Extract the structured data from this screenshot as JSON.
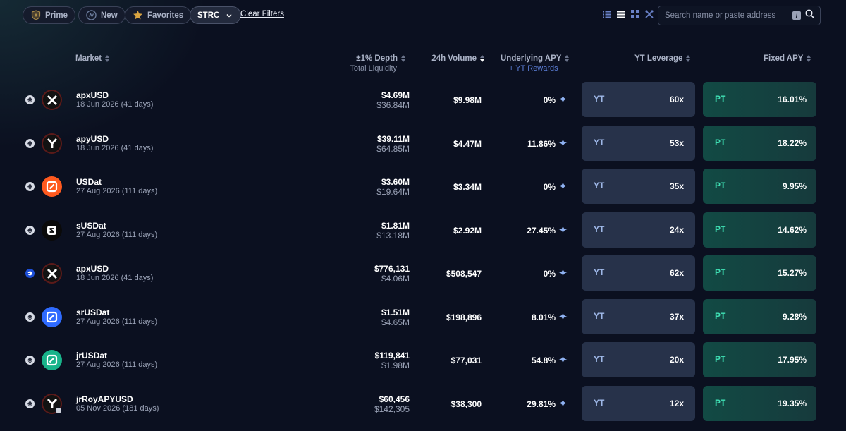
{
  "filters": {
    "prime_label": "Prime",
    "new_label": "New",
    "favorites_label": "Favorites",
    "strc_label": "STRC",
    "clear_label": "Clear Filters"
  },
  "search": {
    "placeholder": "Search name or paste address",
    "shortcut": "/"
  },
  "header": {
    "market": "Market",
    "depth": "±1% Depth",
    "total_liquidity": "Total Liquidity",
    "volume": "24h Volume",
    "underlying_apy": "Underlying APY",
    "yt_rewards": "+ YT Rewards",
    "yt_leverage": "YT Leverage",
    "fixed_apy": "Fixed APY"
  },
  "colors": {
    "background": "#0b1020",
    "yt_card": "#27324a",
    "pt_card": "#124a44",
    "pt_accent": "#3fe0b4",
    "yt_accent": "#9fb8e8"
  },
  "rows": [
    {
      "name": "apxUSD",
      "expiry": "18 Jun 2026 (41 days)",
      "depth": "$4.69M",
      "liquidity": "$36.84M",
      "volume": "$9.98M",
      "apy": "0%",
      "yt_tag": "YT",
      "yt_leverage": "60x",
      "pt_tag": "PT",
      "fixed_apy": "16.01%",
      "chain": "ethereum-icon",
      "icon": "apx-icon"
    },
    {
      "name": "apyUSD",
      "expiry": "18 Jun 2026 (41 days)",
      "depth": "$39.11M",
      "liquidity": "$64.85M",
      "volume": "$4.47M",
      "apy": "11.86%",
      "yt_tag": "YT",
      "yt_leverage": "53x",
      "pt_tag": "PT",
      "fixed_apy": "18.22%",
      "chain": "ethereum-icon",
      "icon": "apy-icon"
    },
    {
      "name": "USDat",
      "expiry": "27 Aug 2026 (111 days)",
      "depth": "$3.60M",
      "liquidity": "$19.64M",
      "volume": "$3.34M",
      "apy": "0%",
      "yt_tag": "YT",
      "yt_leverage": "35x",
      "pt_tag": "PT",
      "fixed_apy": "9.95%",
      "chain": "ethereum-icon",
      "icon": "usdat-icon"
    },
    {
      "name": "sUSDat",
      "expiry": "27 Aug 2026 (111 days)",
      "depth": "$1.81M",
      "liquidity": "$13.18M",
      "volume": "$2.92M",
      "apy": "27.45%",
      "yt_tag": "YT",
      "yt_leverage": "24x",
      "pt_tag": "PT",
      "fixed_apy": "14.62%",
      "chain": "ethereum-icon",
      "icon": "susdat-icon"
    },
    {
      "name": "apxUSD",
      "expiry": "18 Jun 2026 (41 days)",
      "depth": "$776,131",
      "liquidity": "$4.06M",
      "volume": "$508,547",
      "apy": "0%",
      "yt_tag": "YT",
      "yt_leverage": "62x",
      "pt_tag": "PT",
      "fixed_apy": "15.27%",
      "chain": "base-icon",
      "icon": "apx-icon"
    },
    {
      "name": "srUSDat",
      "expiry": "27 Aug 2026 (111 days)",
      "depth": "$1.51M",
      "liquidity": "$4.65M",
      "volume": "$198,896",
      "apy": "8.01%",
      "yt_tag": "YT",
      "yt_leverage": "37x",
      "pt_tag": "PT",
      "fixed_apy": "9.28%",
      "chain": "ethereum-icon",
      "icon": "srusdat-icon"
    },
    {
      "name": "jrUSDat",
      "expiry": "27 Aug 2026 (111 days)",
      "depth": "$119,841",
      "liquidity": "$1.98M",
      "volume": "$77,031",
      "apy": "54.8%",
      "yt_tag": "YT",
      "yt_leverage": "20x",
      "pt_tag": "PT",
      "fixed_apy": "17.95%",
      "chain": "ethereum-icon",
      "icon": "jrusdat-icon"
    },
    {
      "name": "jrRoyAPYUSD",
      "expiry": "05 Nov 2026 (181 days)",
      "depth": "$60,456",
      "liquidity": "$142,305",
      "volume": "$38,300",
      "apy": "29.81%",
      "yt_tag": "YT",
      "yt_leverage": "12x",
      "pt_tag": "PT",
      "fixed_apy": "19.35%",
      "chain": "ethereum-icon",
      "icon": "jrroyapy-icon"
    }
  ]
}
